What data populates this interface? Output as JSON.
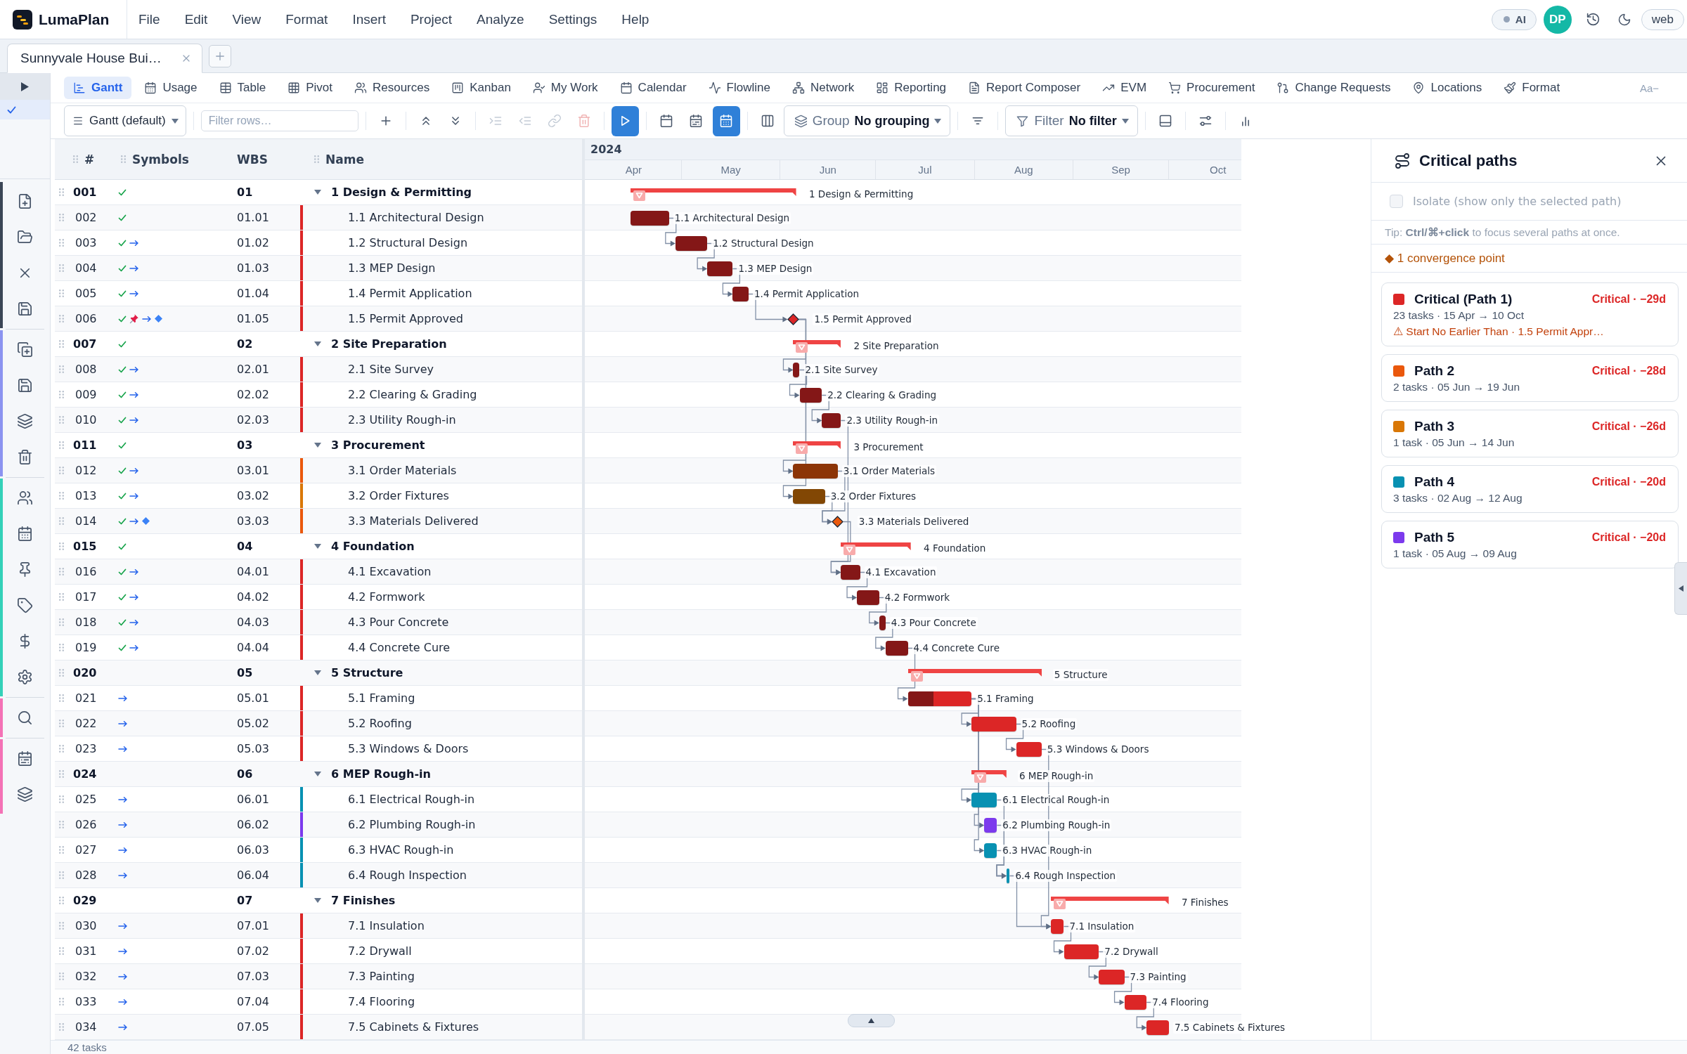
{
  "app": {
    "name": "LumaPlan"
  },
  "menu": [
    "File",
    "Edit",
    "View",
    "Format",
    "Insert",
    "Project",
    "Analyze",
    "Settings",
    "Help"
  ],
  "header": {
    "ai": {
      "label": "AI",
      "on": false
    },
    "avatar": "DP",
    "environment": "web"
  },
  "documents": [
    {
      "title": "Sunnyvale House Bui…",
      "selected": true
    }
  ],
  "views": [
    {
      "label": "Gantt",
      "selected": true
    },
    {
      "label": "Usage",
      "selected": false
    },
    {
      "label": "Table",
      "selected": false
    },
    {
      "label": "Pivot",
      "selected": false
    },
    {
      "label": "Resources",
      "selected": false
    },
    {
      "label": "Kanban",
      "selected": false
    },
    {
      "label": "My Work",
      "selected": false
    },
    {
      "label": "Calendar",
      "selected": false
    },
    {
      "label": "Flowline",
      "selected": false
    },
    {
      "label": "Network",
      "selected": false
    },
    {
      "label": "Reporting",
      "selected": false
    },
    {
      "label": "Report Composer",
      "selected": false
    },
    {
      "label": "EVM",
      "selected": false
    },
    {
      "label": "Procurement",
      "selected": false
    },
    {
      "label": "Change Requests",
      "selected": false
    },
    {
      "label": "Locations",
      "selected": false
    },
    {
      "label": "Format",
      "selected": false
    }
  ],
  "font_size_control": "Aa−",
  "toolbar": {
    "view_select": "Gantt (default)",
    "filter_field": {
      "placeholder": "Filter rows…"
    },
    "tools": [
      {
        "kind": "add",
        "disabled": false,
        "on": false
      },
      {
        "kind": "collapse_all",
        "disabled": false,
        "on": false
      },
      {
        "kind": "expand_all",
        "disabled": false,
        "on": false
      },
      {
        "kind": "indent",
        "disabled": true,
        "on": false
      },
      {
        "kind": "outdent",
        "disabled": true,
        "on": false
      },
      {
        "kind": "link",
        "disabled": true,
        "on": false
      },
      {
        "kind": "delete",
        "disabled": true,
        "on": false
      },
      {
        "kind": "run",
        "disabled": false,
        "on": true
      },
      {
        "kind": "calendar",
        "disabled": false,
        "on": false
      },
      {
        "kind": "calendar_list",
        "disabled": false,
        "on": false
      },
      {
        "kind": "calendar_grid",
        "disabled": false,
        "on": true
      },
      {
        "kind": "columns",
        "disabled": false,
        "on": false
      },
      {
        "kind": "sort",
        "disabled": false,
        "on": false
      },
      {
        "kind": "panel",
        "disabled": false,
        "on": false
      },
      {
        "kind": "sliders",
        "disabled": false,
        "on": false
      },
      {
        "kind": "chart",
        "disabled": false,
        "on": false
      }
    ],
    "group_select": {
      "label": "Group",
      "value": "No grouping"
    },
    "filter_select": {
      "label": "Filter",
      "value": "No filter"
    }
  },
  "table": {
    "columns": [
      {
        "label": "#",
        "grip": true
      },
      {
        "label": "Symbols",
        "grip": true
      },
      {
        "label": "WBS",
        "grip": false
      },
      {
        "label": "Name",
        "grip": true
      }
    ],
    "rows": [
      {
        "num": "001",
        "wbs": "01",
        "name": "1 Design & Permitting",
        "kind": "summary",
        "expanded": true,
        "done": true,
        "pinned": false,
        "linked": false,
        "milestone": false
      },
      {
        "num": "002",
        "wbs": "01.01",
        "name": "1.1 Architectural Design",
        "kind": "task",
        "done": true,
        "pinned": false,
        "linked": false,
        "milestone": false,
        "color": "#dc2626"
      },
      {
        "num": "003",
        "wbs": "01.02",
        "name": "1.2 Structural Design",
        "kind": "task",
        "done": true,
        "pinned": false,
        "linked": true,
        "milestone": false,
        "color": "#dc2626"
      },
      {
        "num": "004",
        "wbs": "01.03",
        "name": "1.3 MEP Design",
        "kind": "task",
        "done": true,
        "pinned": false,
        "linked": true,
        "milestone": false,
        "color": "#dc2626"
      },
      {
        "num": "005",
        "wbs": "01.04",
        "name": "1.4 Permit Application",
        "kind": "task",
        "done": true,
        "pinned": false,
        "linked": true,
        "milestone": false,
        "color": "#dc2626"
      },
      {
        "num": "006",
        "wbs": "01.05",
        "name": "1.5 Permit Approved",
        "kind": "task",
        "done": true,
        "pinned": true,
        "linked": true,
        "milestone": true,
        "color": "#dc2626"
      },
      {
        "num": "007",
        "wbs": "02",
        "name": "2 Site Preparation",
        "kind": "summary",
        "expanded": true,
        "done": true,
        "pinned": false,
        "linked": false,
        "milestone": false
      },
      {
        "num": "008",
        "wbs": "02.01",
        "name": "2.1 Site Survey",
        "kind": "task",
        "done": true,
        "pinned": false,
        "linked": true,
        "milestone": false,
        "color": "#dc2626"
      },
      {
        "num": "009",
        "wbs": "02.02",
        "name": "2.2 Clearing & Grading",
        "kind": "task",
        "done": true,
        "pinned": false,
        "linked": true,
        "milestone": false,
        "color": "#dc2626"
      },
      {
        "num": "010",
        "wbs": "02.03",
        "name": "2.3 Utility Rough-in",
        "kind": "task",
        "done": true,
        "pinned": false,
        "linked": true,
        "milestone": false,
        "color": "#dc2626"
      },
      {
        "num": "011",
        "wbs": "03",
        "name": "3 Procurement",
        "kind": "summary",
        "expanded": true,
        "done": true,
        "pinned": false,
        "linked": false,
        "milestone": false
      },
      {
        "num": "012",
        "wbs": "03.01",
        "name": "3.1 Order Materials",
        "kind": "task",
        "done": true,
        "pinned": false,
        "linked": true,
        "milestone": false,
        "color": "#ea580c"
      },
      {
        "num": "013",
        "wbs": "03.02",
        "name": "3.2 Order Fixtures",
        "kind": "task",
        "done": true,
        "pinned": false,
        "linked": true,
        "milestone": false,
        "color": "#d97706"
      },
      {
        "num": "014",
        "wbs": "03.03",
        "name": "3.3 Materials Delivered",
        "kind": "task",
        "done": true,
        "pinned": false,
        "linked": true,
        "milestone": true,
        "color": "#ea580c"
      },
      {
        "num": "015",
        "wbs": "04",
        "name": "4 Foundation",
        "kind": "summary",
        "expanded": true,
        "done": true,
        "pinned": false,
        "linked": false,
        "milestone": false
      },
      {
        "num": "016",
        "wbs": "04.01",
        "name": "4.1 Excavation",
        "kind": "task",
        "done": true,
        "pinned": false,
        "linked": true,
        "milestone": false,
        "color": "#dc2626"
      },
      {
        "num": "017",
        "wbs": "04.02",
        "name": "4.2 Formwork",
        "kind": "task",
        "done": true,
        "pinned": false,
        "linked": true,
        "milestone": false,
        "color": "#dc2626"
      },
      {
        "num": "018",
        "wbs": "04.03",
        "name": "4.3 Pour Concrete",
        "kind": "task",
        "done": true,
        "pinned": false,
        "linked": true,
        "milestone": false,
        "color": "#dc2626"
      },
      {
        "num": "019",
        "wbs": "04.04",
        "name": "4.4 Concrete Cure",
        "kind": "task",
        "done": true,
        "pinned": false,
        "linked": true,
        "milestone": false,
        "color": "#dc2626"
      },
      {
        "num": "020",
        "wbs": "05",
        "name": "5 Structure",
        "kind": "summary",
        "expanded": true,
        "done": false,
        "pinned": false,
        "linked": false,
        "milestone": false
      },
      {
        "num": "021",
        "wbs": "05.01",
        "name": "5.1 Framing",
        "kind": "task",
        "done": false,
        "pinned": false,
        "linked": true,
        "milestone": false,
        "color": "#dc2626"
      },
      {
        "num": "022",
        "wbs": "05.02",
        "name": "5.2 Roofing",
        "kind": "task",
        "done": false,
        "pinned": false,
        "linked": true,
        "milestone": false,
        "color": "#dc2626"
      },
      {
        "num": "023",
        "wbs": "05.03",
        "name": "5.3 Windows & Doors",
        "kind": "task",
        "done": false,
        "pinned": false,
        "linked": true,
        "milestone": false,
        "color": "#dc2626"
      },
      {
        "num": "024",
        "wbs": "06",
        "name": "6 MEP Rough-in",
        "kind": "summary",
        "expanded": true,
        "done": false,
        "pinned": false,
        "linked": false,
        "milestone": false
      },
      {
        "num": "025",
        "wbs": "06.01",
        "name": "6.1 Electrical Rough-in",
        "kind": "task",
        "done": false,
        "pinned": false,
        "linked": true,
        "milestone": false,
        "color": "#0891b2"
      },
      {
        "num": "026",
        "wbs": "06.02",
        "name": "6.2 Plumbing Rough-in",
        "kind": "task",
        "done": false,
        "pinned": false,
        "linked": true,
        "milestone": false,
        "color": "#7c3aed"
      },
      {
        "num": "027",
        "wbs": "06.03",
        "name": "6.3 HVAC Rough-in",
        "kind": "task",
        "done": false,
        "pinned": false,
        "linked": true,
        "milestone": false,
        "color": "#0891b2"
      },
      {
        "num": "028",
        "wbs": "06.04",
        "name": "6.4 Rough Inspection",
        "kind": "task",
        "done": false,
        "pinned": false,
        "linked": true,
        "milestone": false,
        "color": "#0891b2"
      },
      {
        "num": "029",
        "wbs": "07",
        "name": "7 Finishes",
        "kind": "summary",
        "expanded": true,
        "done": false,
        "pinned": false,
        "linked": false,
        "milestone": false
      },
      {
        "num": "030",
        "wbs": "07.01",
        "name": "7.1 Insulation",
        "kind": "task",
        "done": false,
        "pinned": false,
        "linked": true,
        "milestone": false,
        "color": "#dc2626"
      },
      {
        "num": "031",
        "wbs": "07.02",
        "name": "7.2 Drywall",
        "kind": "task",
        "done": false,
        "pinned": false,
        "linked": true,
        "milestone": false,
        "color": "#dc2626"
      },
      {
        "num": "032",
        "wbs": "07.03",
        "name": "7.3 Painting",
        "kind": "task",
        "done": false,
        "pinned": false,
        "linked": true,
        "milestone": false,
        "color": "#dc2626"
      },
      {
        "num": "033",
        "wbs": "07.04",
        "name": "7.4 Flooring",
        "kind": "task",
        "done": false,
        "pinned": false,
        "linked": true,
        "milestone": false,
        "color": "#dc2626"
      },
      {
        "num": "034",
        "wbs": "07.05",
        "name": "7.5 Cabinets & Fixtures",
        "kind": "task",
        "done": false,
        "pinned": false,
        "linked": true,
        "milestone": false,
        "color": "#dc2626"
      }
    ],
    "footer": "42 tasks"
  },
  "gantt": {
    "year": "2024",
    "months": [
      "Apr",
      "May",
      "Jun",
      "Jul",
      "Aug",
      "Sep",
      "Oct"
    ],
    "bars": [
      {
        "label": "1 Design & Permitting",
        "kind": "summary",
        "color": "#ef4444"
      },
      {
        "label": "1.1 Architectural Design",
        "kind": "task",
        "color": "#841717"
      },
      {
        "label": "1.2 Structural Design",
        "kind": "task",
        "color": "#841717"
      },
      {
        "label": "1.3 MEP Design",
        "kind": "task",
        "color": "#841717"
      },
      {
        "label": "1.4 Permit Application",
        "kind": "task",
        "color": "#841717"
      },
      {
        "label": "1.5 Permit Approved",
        "kind": "milestone",
        "color": "#dc2626"
      },
      {
        "label": "2 Site Preparation",
        "kind": "summary",
        "color": "#ef4444"
      },
      {
        "label": "2.1 Site Survey",
        "kind": "task",
        "color": "#841717"
      },
      {
        "label": "2.2 Clearing & Grading",
        "kind": "task",
        "color": "#841717"
      },
      {
        "label": "2.3 Utility Rough-in",
        "kind": "task",
        "color": "#841717"
      },
      {
        "label": "3 Procurement",
        "kind": "summary",
        "color": "#ef4444"
      },
      {
        "label": "3.1 Order Materials",
        "kind": "task",
        "color": "#8c3507"
      },
      {
        "label": "3.2 Order Fixtures",
        "kind": "task",
        "color": "#824704"
      },
      {
        "label": "3.3 Materials Delivered",
        "kind": "milestone",
        "color": "#ea580c"
      },
      {
        "label": "4 Foundation",
        "kind": "summary",
        "color": "#ef4444"
      },
      {
        "label": "4.1 Excavation",
        "kind": "task",
        "color": "#841717"
      },
      {
        "label": "4.2 Formwork",
        "kind": "task",
        "color": "#841717"
      },
      {
        "label": "4.3 Pour Concrete",
        "kind": "task",
        "color": "#841717"
      },
      {
        "label": "4.4 Concrete Cure",
        "kind": "task",
        "color": "#841717"
      },
      {
        "label": "5 Structure",
        "kind": "summary",
        "color": "#ef4444"
      },
      {
        "label": "5.1 Framing",
        "kind": "task",
        "color": "#dc2626",
        "level": 0.4
      },
      {
        "label": "5.2 Roofing",
        "kind": "task",
        "color": "#dc2626"
      },
      {
        "label": "5.3 Windows & Doors",
        "kind": "task",
        "color": "#dc2626"
      },
      {
        "label": "6 MEP Rough-in",
        "kind": "summary",
        "color": "#ef4444"
      },
      {
        "label": "6.1 Electrical Rough-in",
        "kind": "task",
        "color": "#0891b2"
      },
      {
        "label": "6.2 Plumbing Rough-in",
        "kind": "task",
        "color": "#7c3aed"
      },
      {
        "label": "6.3 HVAC Rough-in",
        "kind": "task",
        "color": "#0891b2"
      },
      {
        "label": "6.4 Rough Inspection",
        "kind": "task",
        "color": "#0891b2"
      },
      {
        "label": "7 Finishes",
        "kind": "summary",
        "color": "#ef4444"
      },
      {
        "label": "7.1 Insulation",
        "kind": "task",
        "color": "#dc2626"
      },
      {
        "label": "7.2 Drywall",
        "kind": "task",
        "color": "#dc2626"
      },
      {
        "label": "7.3 Painting",
        "kind": "task",
        "color": "#dc2626"
      },
      {
        "label": "7.4 Flooring",
        "kind": "task",
        "color": "#dc2626"
      },
      {
        "label": "7.5 Cabinets & Fixtures",
        "kind": "task",
        "color": "#dc2626"
      }
    ]
  },
  "critical_paths": {
    "title": "Critical paths",
    "isolate": {
      "label": "Isolate (show only the selected path)",
      "checked": false,
      "disabled": true
    },
    "tip": "Tip: **Ctrl/⌘+click** to focus several paths at once.",
    "convergence": "◆ 1 convergence point",
    "paths": [
      {
        "name": "Critical (Path 1)",
        "color": "#dc2626",
        "status": "Critical · −29d",
        "summary": "23 tasks · 15 Apr → 10 Oct",
        "warning": "⚠ Start No Earlier Than · 1.5 Permit Appr…"
      },
      {
        "name": "Path 2",
        "color": "#ea580c",
        "status": "Critical · −28d",
        "summary": "2 tasks · 05 Jun → 19 Jun"
      },
      {
        "name": "Path 3",
        "color": "#d97706",
        "status": "Critical · −26d",
        "summary": "1 task · 05 Jun → 14 Jun"
      },
      {
        "name": "Path 4",
        "color": "#0891b2",
        "status": "Critical · −20d",
        "summary": "3 tasks · 02 Aug → 12 Aug"
      },
      {
        "name": "Path 5",
        "color": "#7c3aed",
        "status": "Critical · −20d",
        "summary": "1 task · 05 Aug → 09 Aug"
      }
    ]
  }
}
